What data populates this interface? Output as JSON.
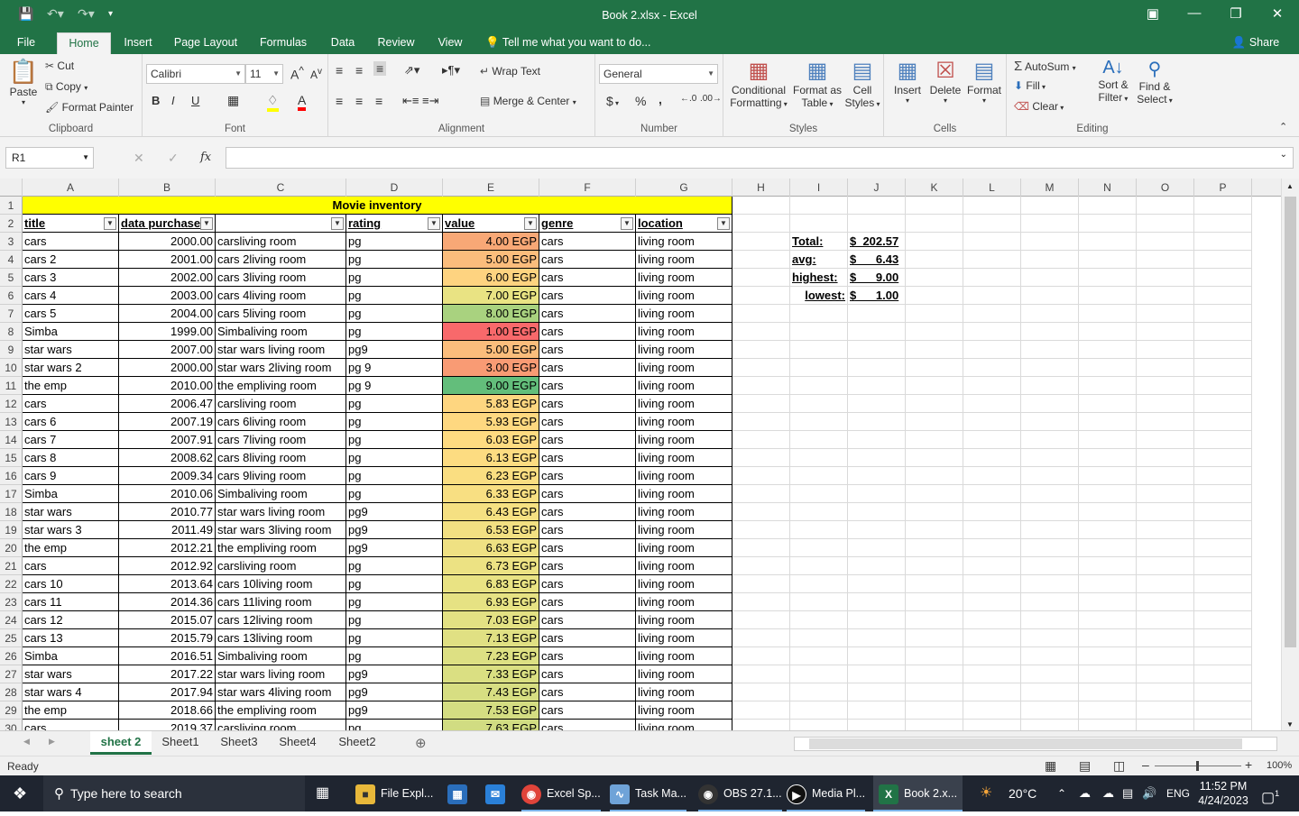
{
  "window": {
    "title": "Book 2.xlsx - Excel"
  },
  "ribbon_tabs": [
    "File",
    "Home",
    "Insert",
    "Page Layout",
    "Formulas",
    "Data",
    "Review",
    "View"
  ],
  "tell_me": "Tell me what you want to do...",
  "share": "Share",
  "clipboard": {
    "paste": "Paste",
    "cut": "Cut",
    "copy": "Copy",
    "format_painter": "Format Painter",
    "label": "Clipboard"
  },
  "font": {
    "name": "Calibri",
    "size": "11",
    "label": "Font",
    "bold": "B",
    "italic": "I",
    "underline": "U"
  },
  "alignment": {
    "wrap": "Wrap Text",
    "merge": "Merge & Center",
    "label": "Alignment"
  },
  "number": {
    "format": "General",
    "label": "Number",
    "currency": "$",
    "percent": "%",
    "comma": ","
  },
  "styles": {
    "cond": "Conditional",
    "cond2": "Formatting",
    "fmt": "Format as",
    "fmt2": "Table",
    "cell": "Cell",
    "cell2": "Styles",
    "label": "Styles"
  },
  "cells_group": {
    "insert": "Insert",
    "delete": "Delete",
    "format": "Format",
    "label": "Cells"
  },
  "editing": {
    "autosum": "AutoSum",
    "fill": "Fill",
    "clear": "Clear",
    "sort": "Sort &",
    "sort2": "Filter",
    "find": "Find &",
    "find2": "Select",
    "label": "Editing"
  },
  "namebox": "R1",
  "fx": "fx",
  "columns": [
    "A",
    "B",
    "C",
    "D",
    "E",
    "F",
    "G",
    "H",
    "I",
    "J",
    "K",
    "L",
    "M",
    "N",
    "O",
    "P"
  ],
  "sheet_title": "Movie inventory",
  "headers": [
    "title",
    "data purchase",
    "",
    "rating",
    "value",
    "genre",
    "location"
  ],
  "rows": [
    [
      "cars",
      "2000.00",
      "carsliving room",
      "pg",
      "4.00 EGP",
      "cars",
      "living room"
    ],
    [
      "cars 2",
      "2001.00",
      "cars 2living room",
      "pg",
      "5.00 EGP",
      "cars",
      "living room"
    ],
    [
      "cars 3",
      "2002.00",
      "cars 3living room",
      "pg",
      "6.00 EGP",
      "cars",
      "living room"
    ],
    [
      "cars 4",
      "2003.00",
      "cars 4living room",
      "pg",
      "7.00 EGP",
      "cars",
      "living room"
    ],
    [
      "cars 5",
      "2004.00",
      "cars 5living room",
      "pg",
      "8.00 EGP",
      "cars",
      "living room"
    ],
    [
      "Simba",
      "1999.00",
      "Simbaliving room",
      "pg",
      "1.00 EGP",
      "cars",
      "living room"
    ],
    [
      "star wars",
      "2007.00",
      "star wars living room",
      "pg9",
      "5.00 EGP",
      "cars",
      "living room"
    ],
    [
      "star wars 2",
      "2000.00",
      "star wars 2living room",
      "pg 9",
      "3.00 EGP",
      "cars",
      "living room"
    ],
    [
      "the emp",
      "2010.00",
      "the empliving room",
      "pg 9",
      "9.00 EGP",
      "cars",
      "living room"
    ],
    [
      "cars",
      "2006.47",
      "carsliving room",
      "pg",
      "5.83 EGP",
      "cars",
      "living room"
    ],
    [
      "cars 6",
      "2007.19",
      "cars 6living room",
      "pg",
      "5.93 EGP",
      "cars",
      "living room"
    ],
    [
      "cars 7",
      "2007.91",
      "cars 7living room",
      "pg",
      "6.03 EGP",
      "cars",
      "living room"
    ],
    [
      "cars 8",
      "2008.62",
      "cars 8living room",
      "pg",
      "6.13 EGP",
      "cars",
      "living room"
    ],
    [
      "cars 9",
      "2009.34",
      "cars 9living room",
      "pg",
      "6.23 EGP",
      "cars",
      "living room"
    ],
    [
      "Simba",
      "2010.06",
      "Simbaliving room",
      "pg",
      "6.33 EGP",
      "cars",
      "living room"
    ],
    [
      "star wars",
      "2010.77",
      "star wars living room",
      "pg9",
      "6.43 EGP",
      "cars",
      "living room"
    ],
    [
      "star wars 3",
      "2011.49",
      "star wars 3living room",
      "pg9",
      "6.53 EGP",
      "cars",
      "living room"
    ],
    [
      "the emp",
      "2012.21",
      "the empliving room",
      "pg9",
      "6.63 EGP",
      "cars",
      "living room"
    ],
    [
      "cars",
      "2012.92",
      "carsliving room",
      "pg",
      "6.73 EGP",
      "cars",
      "living room"
    ],
    [
      "cars 10",
      "2013.64",
      "cars 10living room",
      "pg",
      "6.83 EGP",
      "cars",
      "living room"
    ],
    [
      "cars 11",
      "2014.36",
      "cars 11living room",
      "pg",
      "6.93 EGP",
      "cars",
      "living room"
    ],
    [
      "cars 12",
      "2015.07",
      "cars 12living room",
      "pg",
      "7.03 EGP",
      "cars",
      "living room"
    ],
    [
      "cars 13",
      "2015.79",
      "cars 13living room",
      "pg",
      "7.13 EGP",
      "cars",
      "living room"
    ],
    [
      "Simba",
      "2016.51",
      "Simbaliving room",
      "pg",
      "7.23 EGP",
      "cars",
      "living room"
    ],
    [
      "star wars",
      "2017.22",
      "star wars living room",
      "pg9",
      "7.33 EGP",
      "cars",
      "living room"
    ],
    [
      "star wars 4",
      "2017.94",
      "star wars 4living room",
      "pg9",
      "7.43 EGP",
      "cars",
      "living room"
    ],
    [
      "the emp",
      "2018.66",
      "the empliving room",
      "pg9",
      "7.53 EGP",
      "cars",
      "living room"
    ],
    [
      "cars",
      "2019.37",
      "carsliving room",
      "pg",
      "7.63 EGP",
      "cars",
      "living room"
    ]
  ],
  "value_colors": [
    "#f8a876",
    "#fbbd7c",
    "#fed380",
    "#e9e383",
    "#a9d27f",
    "#f8696b",
    "#fbbd7c",
    "#f99b74",
    "#63be7b",
    "#fed680",
    "#fed880",
    "#fedb81",
    "#fddc81",
    "#fade81",
    "#f8df82",
    "#f5e082",
    "#f2e082",
    "#efe183",
    "#ece283",
    "#e9e383",
    "#e6e283",
    "#e3e183",
    "#e0e083",
    "#dde083",
    "#dadf82",
    "#d7de82",
    "#d4dd82",
    "#d1dc82"
  ],
  "summary": [
    {
      "label": "Total:",
      "value": "$  202.57"
    },
    {
      "label": "avg:",
      "value": "$      6.43"
    },
    {
      "label": "highest:",
      "value": "$      9.00"
    },
    {
      "label": "lowest:",
      "value": "$      1.00"
    }
  ],
  "sheet_tabs": [
    "sheet 2",
    "Sheet1",
    "Sheet3",
    "Sheet4",
    "Sheet2"
  ],
  "status": {
    "ready": "Ready",
    "zoom": "100%"
  },
  "taskbar": {
    "search": "Type here to search",
    "apps": [
      "File Expl...",
      "Excel Sp...",
      "Task Ma...",
      "OBS 27.1...",
      "Media Pl...",
      "Book 2.x..."
    ],
    "temp": "20°C",
    "lang": "ENG",
    "time": "11:52 PM",
    "date": "4/24/2023",
    "notif": "1"
  }
}
